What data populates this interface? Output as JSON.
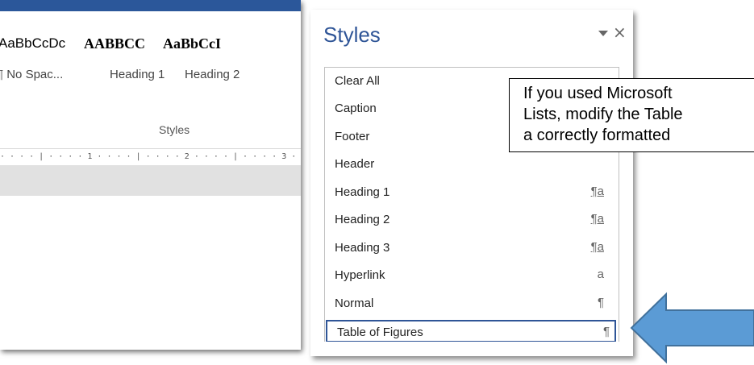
{
  "ribbon": {
    "styles_gallery": [
      {
        "preview": "AaBbCcDc",
        "name": "¶ No Spac..."
      },
      {
        "preview": "AABBCC",
        "name": "Heading 1"
      },
      {
        "preview": "AaBbCcI",
        "name": "Heading 2"
      }
    ],
    "group_label": "Styles",
    "ruler_text": "· · · · | · · · · 1 · · · · | · · · · 2 · · · · | · · · · 3 · ·"
  },
  "styles_pane": {
    "title": "Styles",
    "dropdown_icon": "chevron-down-icon",
    "close_icon": "close-icon",
    "items": [
      {
        "label": "Clear All",
        "glyph": ""
      },
      {
        "label": "Caption",
        "glyph": ""
      },
      {
        "label": "Footer",
        "glyph": ""
      },
      {
        "label": "Header",
        "glyph": ""
      },
      {
        "label": "Heading 1",
        "glyph": "¶a"
      },
      {
        "label": "Heading 2",
        "glyph": "¶a"
      },
      {
        "label": "Heading 3",
        "glyph": "¶a"
      },
      {
        "label": "Hyperlink",
        "glyph": "a"
      },
      {
        "label": "Normal",
        "glyph": "¶"
      },
      {
        "label": "Table of Figures",
        "glyph": "¶",
        "selected": true
      }
    ]
  },
  "callout": {
    "lines": [
      "If you used Microsoft",
      "Lists, modify the Table",
      "a correctly formatted"
    ]
  },
  "colors": {
    "pane_title": "#2f5597",
    "selection_border": "#2f5597",
    "arrow_fill": "#5b9bd5",
    "arrow_stroke": "#41719c",
    "title_strip": "#2b579a"
  }
}
